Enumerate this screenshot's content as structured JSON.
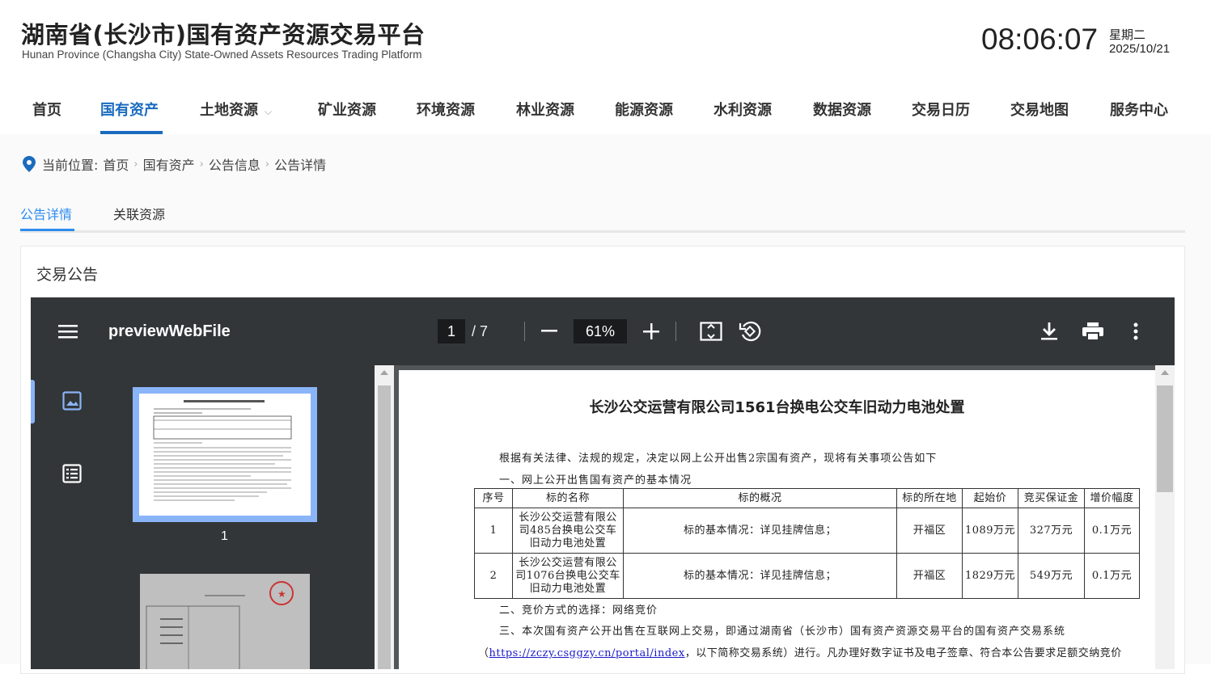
{
  "header": {
    "title": "湖南省(长沙市)国有资产资源交易平台",
    "subtitle": "Hunan Province (Changsha City) State-Owned Assets Resources Trading Platform",
    "time": "08:06:07",
    "weekday": "星期二",
    "date": "2025/10/21"
  },
  "nav": [
    "首页",
    "国有资产",
    "土地资源",
    "矿业资源",
    "环境资源",
    "林业资源",
    "能源资源",
    "水利资源",
    "数据资源",
    "交易日历",
    "交易地图",
    "服务中心"
  ],
  "breadcrumb": {
    "label": "当前位置:",
    "items": [
      "首页",
      "国有资产",
      "公告信息",
      "公告详情"
    ]
  },
  "tabs": [
    "公告详情",
    "关联资源"
  ],
  "card": {
    "title": "交易公告"
  },
  "viewer": {
    "filename": "previewWebFile",
    "page": "1",
    "total": "/  7",
    "zoom": "61%",
    "thumb_page": "1"
  },
  "doc": {
    "title": "长沙公交运营有限公司1561台换电公交车旧动力电池处置",
    "intro": "根据有关法律、法规的规定，决定以网上公开出售2宗国有资产，现将有关事项公告如下",
    "section1": "一、网上公开出售国有资产的基本情况",
    "headers": [
      "序号",
      "标的名称",
      "标的概况",
      "标的所在地",
      "起始价",
      "竞买保证金",
      "增价幅度"
    ],
    "rows": [
      [
        "1",
        "长沙公交运营有限公司485台换电公交车旧动力电池处置",
        "标的基本情况：详见挂牌信息；",
        "开福区",
        "1089万元",
        "327万元",
        "0.1万元"
      ],
      [
        "2",
        "长沙公交运营有限公司1076台换电公交车旧动力电池处置",
        "标的基本情况：详见挂牌信息；",
        "开福区",
        "1829万元",
        "549万元",
        "0.1万元"
      ]
    ],
    "section2": "二、竞价方式的选择：网络竞价",
    "section3": "三、本次国有资产公开出售在互联网上交易，即通过湖南省（长沙市）国有资产资源交易平台的国有资产交易系统",
    "line4_pre": "（",
    "link": "https://zczy.csggzy.cn/portal/index",
    "line4_post": "，以下简称交易系统）进行。凡办理好数字证书及电子签章、符合本公告要求足额交纳竞价"
  },
  "colors": {
    "accent": "#1a6bbf",
    "tab": "#2d8cf0",
    "toolbar": "#323639"
  }
}
